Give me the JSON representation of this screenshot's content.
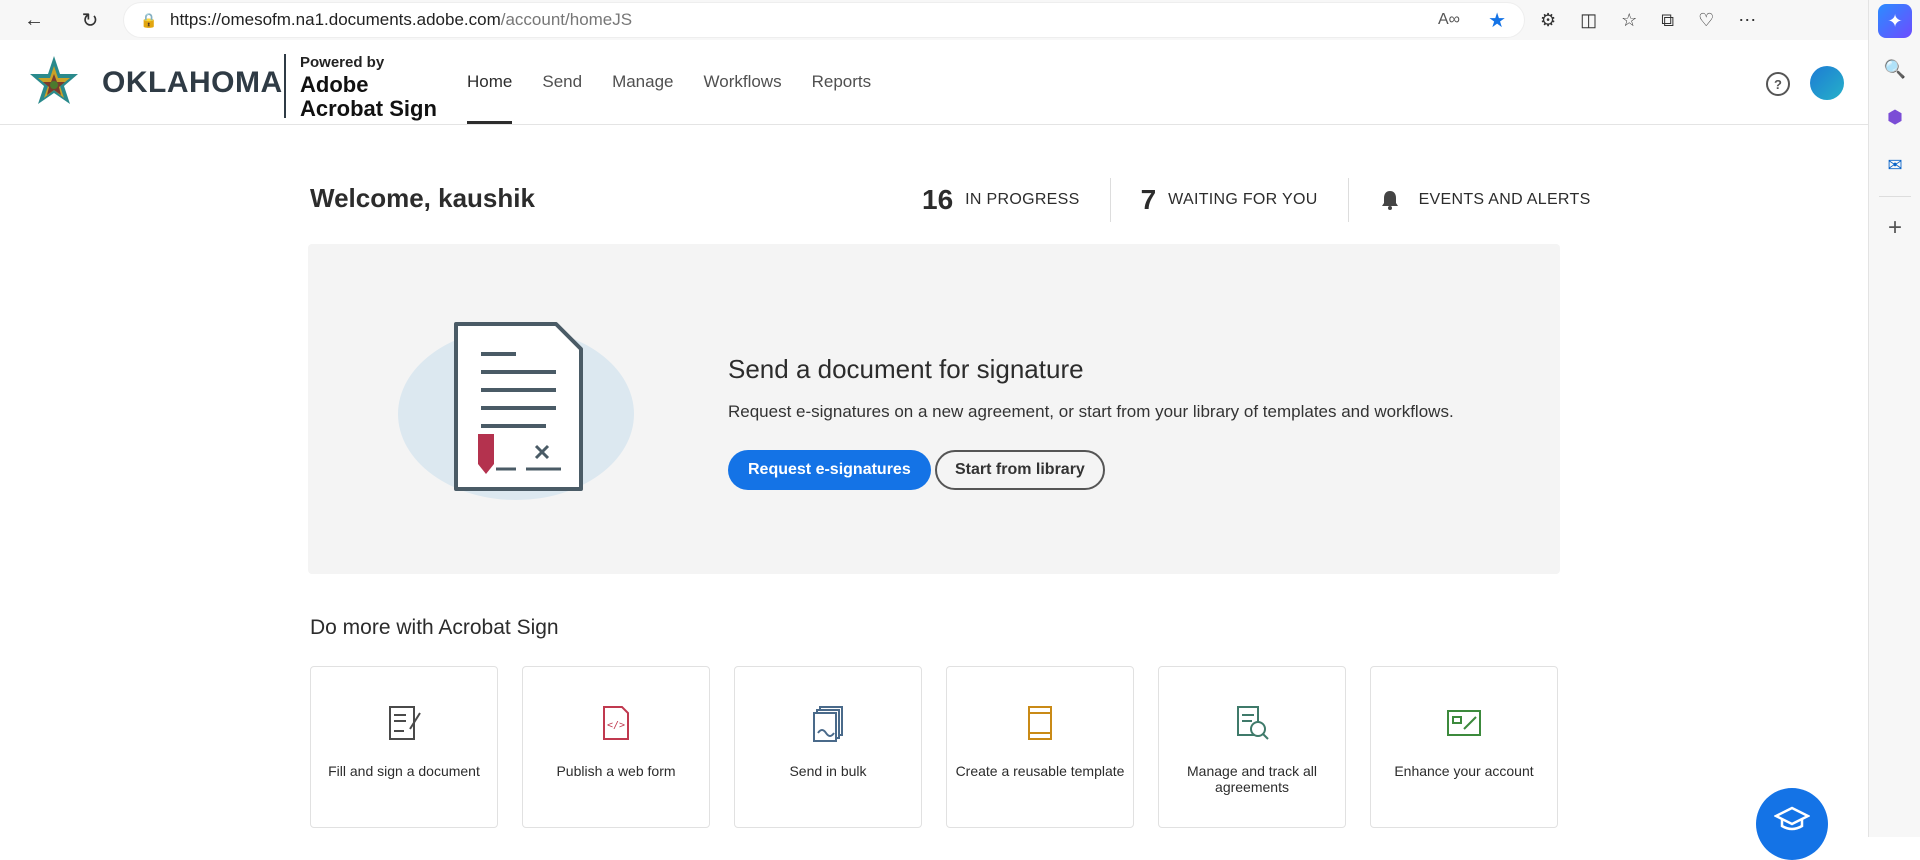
{
  "browser": {
    "url_host": "https://omesofm.na1.documents.adobe.com",
    "url_path": "/account/homeJS"
  },
  "header": {
    "logo_text": "OKLAHOMA",
    "powered_by": "Powered by",
    "product_name_line1": "Adobe",
    "product_name_line2": "Acrobat Sign",
    "nav": [
      {
        "label": "Home",
        "active": true
      },
      {
        "label": "Send",
        "active": false
      },
      {
        "label": "Manage",
        "active": false
      },
      {
        "label": "Workflows",
        "active": false
      },
      {
        "label": "Reports",
        "active": false
      }
    ],
    "help_symbol": "?"
  },
  "welcome": {
    "title": "Welcome, kaushik",
    "in_progress_count": "16",
    "in_progress_label": "IN PROGRESS",
    "waiting_count": "7",
    "waiting_label": "WAITING FOR YOU",
    "events_label": "EVENTS AND ALERTS"
  },
  "hero": {
    "title": "Send a document for signature",
    "description": "Request e-signatures on a new agreement, or start from your library of templates and workflows.",
    "primary_button": "Request e-signatures",
    "secondary_button": "Start from library"
  },
  "more": {
    "title": "Do more with Acrobat Sign",
    "tiles": [
      {
        "label": "Fill and sign a document",
        "icon": "fill-sign-icon"
      },
      {
        "label": "Publish a web form",
        "icon": "web-form-icon"
      },
      {
        "label": "Send in bulk",
        "icon": "send-bulk-icon"
      },
      {
        "label": "Create a reusable template",
        "icon": "template-icon"
      },
      {
        "label": "Manage and track all agreements",
        "icon": "manage-track-icon"
      },
      {
        "label": "Enhance your account",
        "icon": "enhance-account-icon"
      }
    ]
  },
  "colors": {
    "accent": "#1473e6",
    "text": "#2c2c2c",
    "hero_bg": "#f4f4f4"
  }
}
